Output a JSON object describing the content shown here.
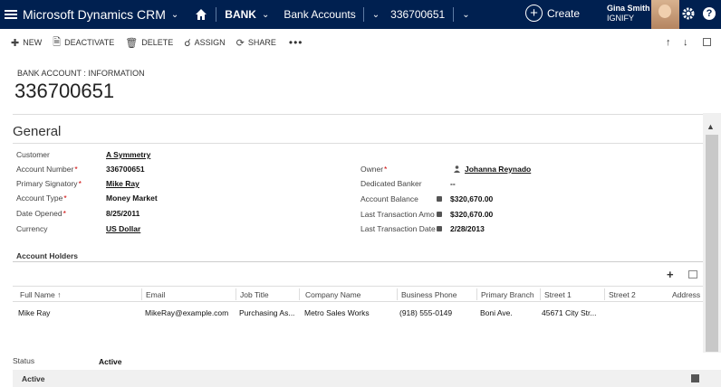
{
  "nav": {
    "brand": "Microsoft Dynamics CRM",
    "area": "BANK",
    "entity": "Bank Accounts",
    "record": "336700651",
    "create": "Create",
    "user_name": "Gina Smith",
    "user_org": "IGNIFY",
    "help": "?"
  },
  "commands": {
    "new": "NEW",
    "deactivate": "DEACTIVATE",
    "delete": "DELETE",
    "assign": "ASSIGN",
    "share": "SHARE",
    "more": "•••"
  },
  "header": {
    "entity_form": "BANK ACCOUNT : INFORMATION",
    "record_name": "336700651"
  },
  "section": {
    "title": "General"
  },
  "left_fields": [
    {
      "label": "Customer",
      "value": "A Symmetry",
      "required": "",
      "link": true
    },
    {
      "label": "Account Number",
      "value": "336700651",
      "required": "*",
      "link": false
    },
    {
      "label": "Primary Signatory",
      "value": "Mike Ray",
      "required": "*",
      "link": true
    },
    {
      "label": "Account Type",
      "value": "Money Market",
      "required": "*",
      "link": false
    },
    {
      "label": "Date Opened",
      "value": "8/25/2011",
      "required": "*",
      "link": false
    },
    {
      "label": "Currency",
      "value": "US Dollar",
      "required": "",
      "link": true
    }
  ],
  "right_fields": [
    {
      "label": "Owner",
      "value": "Johanna Reynado",
      "required": "*"
    },
    {
      "label": "Dedicated Banker",
      "value": "--",
      "required": ""
    },
    {
      "label": "Account Balance",
      "value": "$320,670.00",
      "required": ""
    },
    {
      "label": "Last Transaction Amo",
      "value": "$320,670.00",
      "required": ""
    },
    {
      "label": "Last Transaction Date",
      "value": "2/28/2013",
      "required": ""
    }
  ],
  "subgrid": {
    "title": "Account Holders",
    "columns": [
      "Full Name",
      "Email",
      "Job Title",
      "Company Name",
      "Business Phone",
      "Primary Branch",
      "Street 1",
      "Street 2",
      "Address"
    ],
    "rows": [
      [
        "Mike Ray",
        "MikeRay@example.com",
        "Purchasing As...",
        "Metro Sales Works",
        "(918) 555-0149",
        "Boni Ave.",
        "45671 City Str...",
        "",
        ""
      ]
    ]
  },
  "status": {
    "label": "Status",
    "value": "Active"
  },
  "footer": {
    "state": "Active"
  },
  "colors": {
    "nav_bg": "#002050",
    "required": "#cc0000"
  }
}
